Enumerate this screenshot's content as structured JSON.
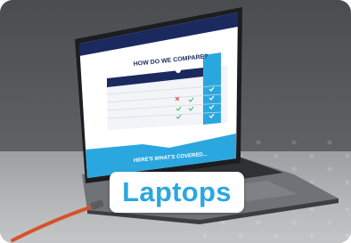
{
  "screen": {
    "heading": "HOW DO WE COMPARE?",
    "bottom_band": "HERE'S WHAT'S COVERED..."
  },
  "label": {
    "text": "Laptops"
  },
  "colors": {
    "accent_blue": "#2ba7df",
    "navy": "#1a2a5e",
    "cable_orange": "#d9502a"
  },
  "icons": [
    "apple-logo-icon",
    "checkmark-icon",
    "cross-icon"
  ]
}
